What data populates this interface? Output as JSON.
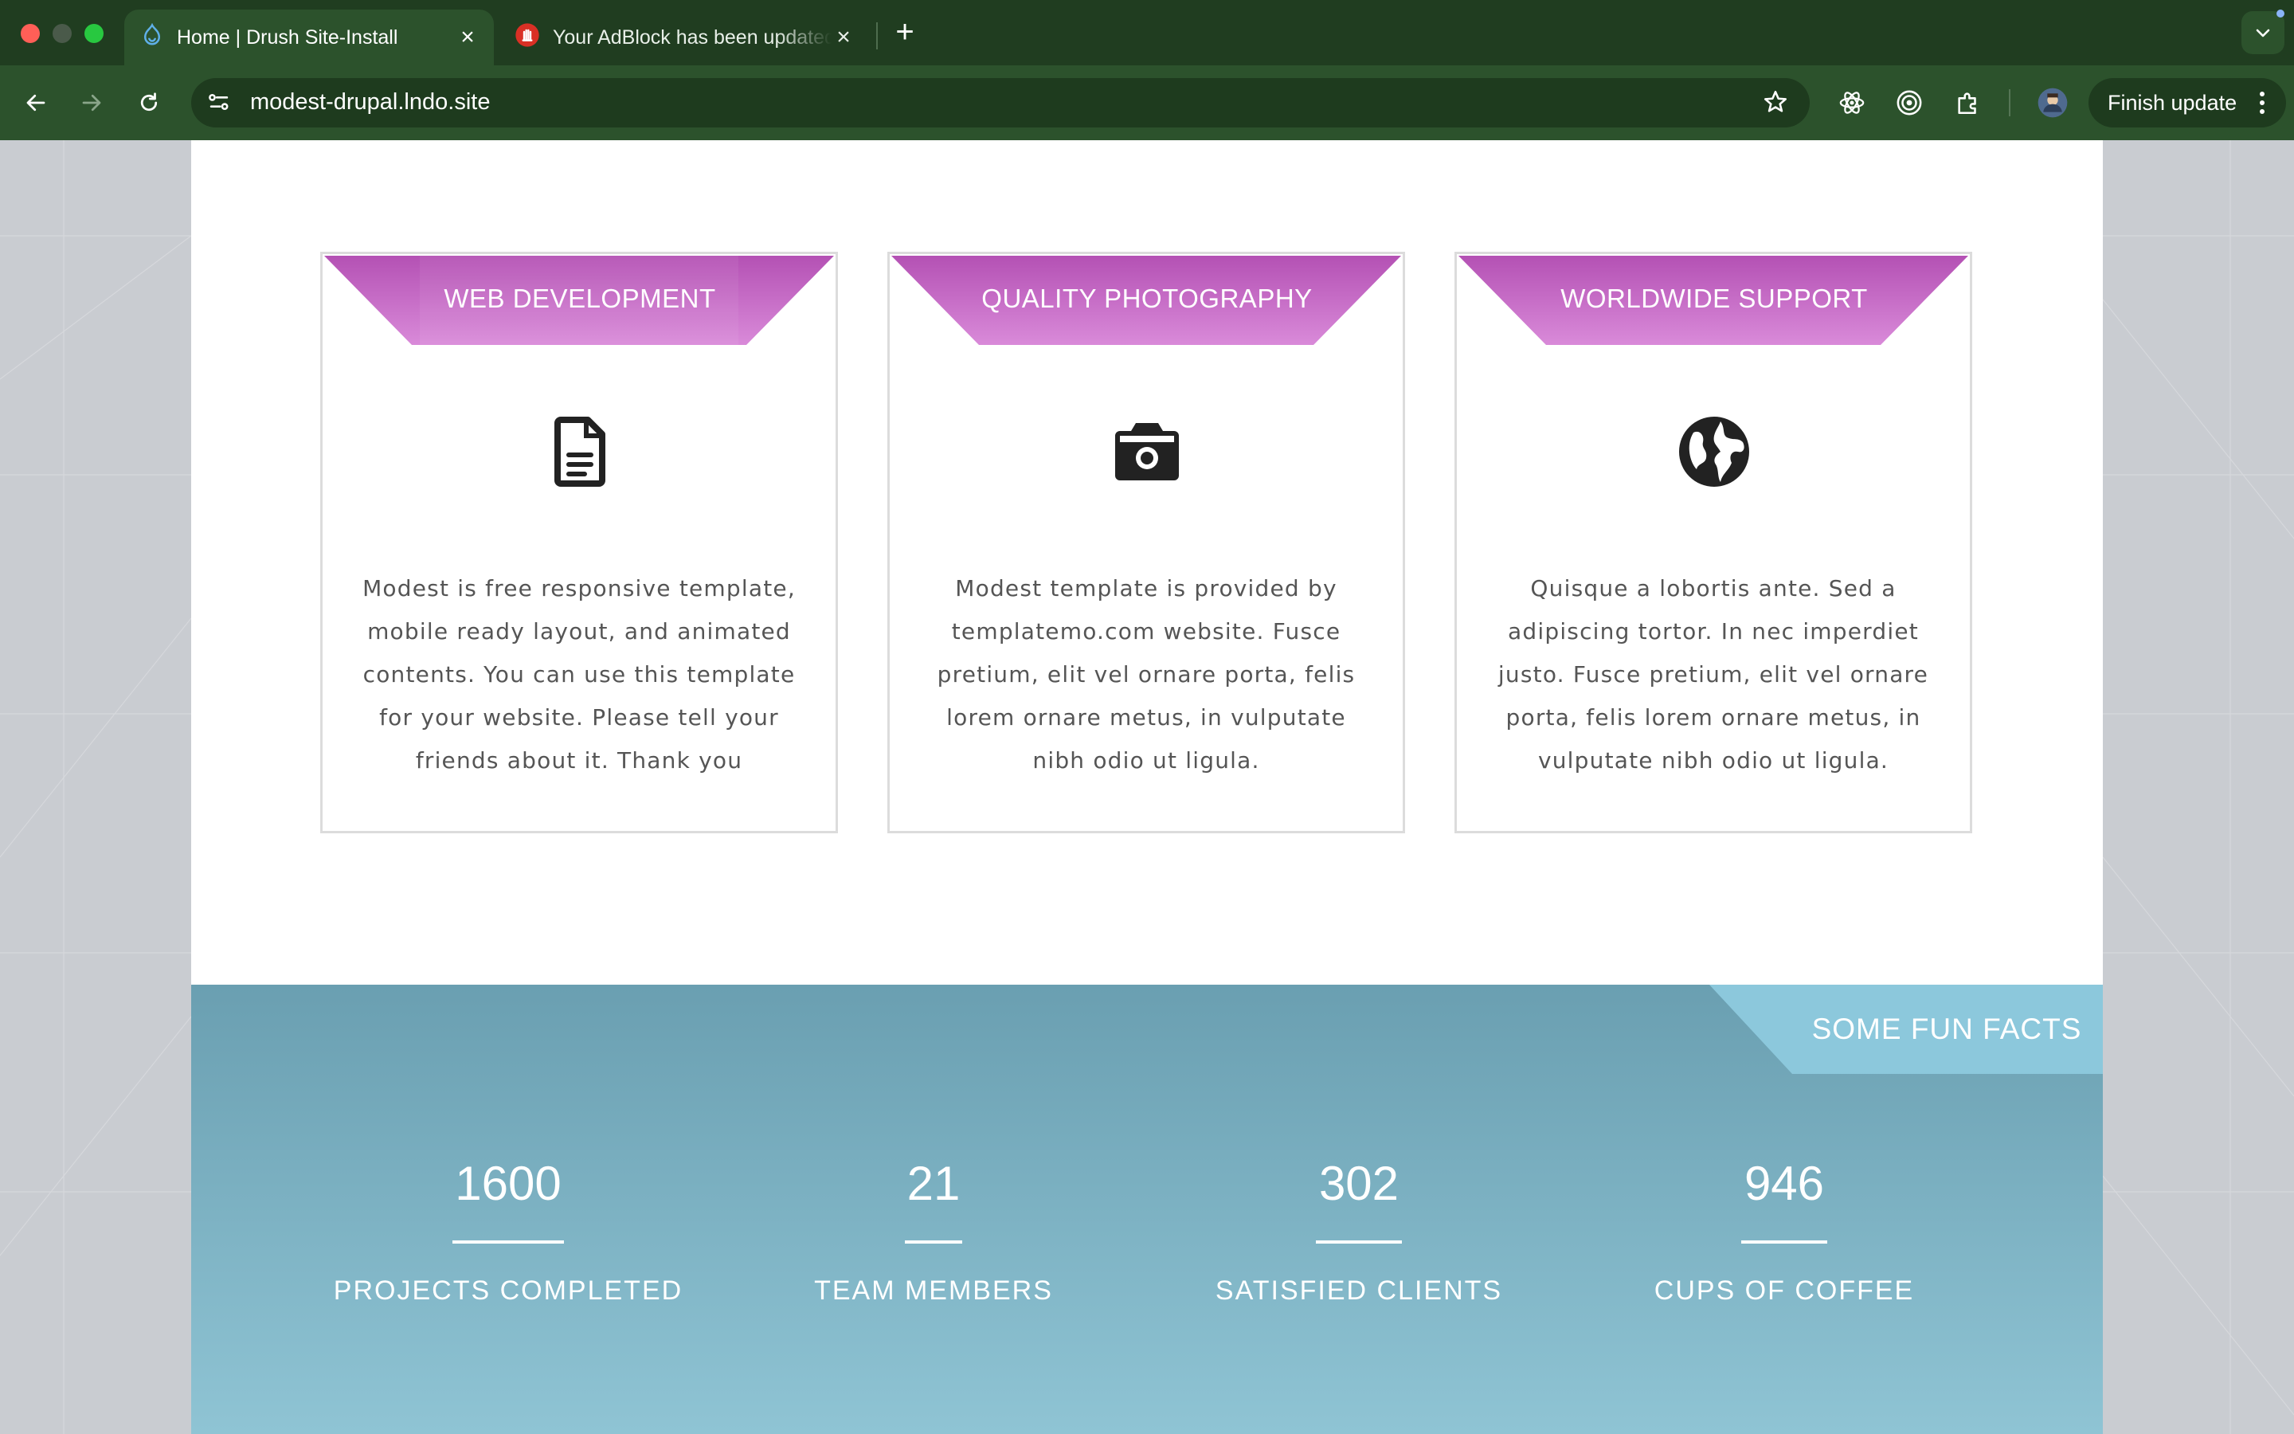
{
  "browser": {
    "tabs": [
      {
        "title": "Home | Drush Site-Install",
        "icon": "drupal-icon",
        "active": true
      },
      {
        "title": "Your AdBlock has been updated",
        "icon": "adblock-icon",
        "active": false
      }
    ],
    "url": "modest-drupal.lndo.site",
    "finish_update_label": "Finish update",
    "colors": {
      "frame": "#203d20",
      "toolbar": "#2c522c",
      "omnibox": "#1e3b1e"
    }
  },
  "services": [
    {
      "title": "WEB DEVELOPMENT",
      "icon": "document-icon",
      "text": "Modest is free responsive template, mobile ready layout, and animated contents. You can use this template for your website. Please tell your friends about it. Thank you"
    },
    {
      "title": "QUALITY PHOTOGRAPHY",
      "icon": "camera-icon",
      "text": "Modest template is provided by templatemo.com website. Fusce pretium, elit vel ornare porta, felis lorem ornare metus, in vulputate nibh odio ut ligula."
    },
    {
      "title": "WORLDWIDE SUPPORT",
      "icon": "globe-icon",
      "text": "Quisque a lobortis ante. Sed a adipiscing tortor. In nec imperdiet justo. Fusce pretium, elit vel ornare porta, felis lorem ornare metus, in vulputate nibh odio ut ligula."
    }
  ],
  "fun_facts": {
    "label": "SOME FUN FACTS",
    "items": [
      {
        "value": "1600",
        "label": "PROJECTS COMPLETED"
      },
      {
        "value": "21",
        "label": "TEAM MEMBERS"
      },
      {
        "value": "302",
        "label": "SATISFIED CLIENTS"
      },
      {
        "value": "946",
        "label": "CUPS OF COFFEE"
      }
    ]
  },
  "colors": {
    "accent_purple": "#c46fc4",
    "facts_teal": "#6a9fb1",
    "facts_tag": "#8cc8dc"
  }
}
